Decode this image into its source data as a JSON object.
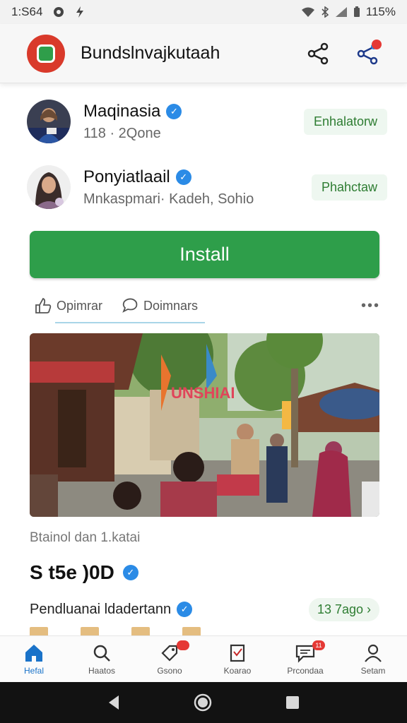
{
  "status_bar": {
    "time": "1:S64",
    "battery": "115%"
  },
  "app_bar": {
    "title": "Bundslnvajkutaah"
  },
  "accounts": [
    {
      "name": "Maqinasia",
      "sub": "118 · 2Qone",
      "chip": "Enhalatorw"
    },
    {
      "name": "Ponyiatlaail",
      "sub": "Mnkaspmari· Kadeh, Sohio",
      "chip": "Phahctaw"
    }
  ],
  "install": {
    "label": "Install"
  },
  "tabs": [
    {
      "label": "Opimrar"
    },
    {
      "label": "Doimnars"
    }
  ],
  "more": "•••",
  "media": {
    "sign_text": "UNSHIAI"
  },
  "media_caption": "Btainol dan 1.katai",
  "price": "S  t5e    )0D",
  "developer": {
    "name": "Pendluanai ldadertann",
    "chip": "13 7ago ›"
  },
  "bottom_nav": [
    {
      "label": "Hefal",
      "icon": "home-icon",
      "active": true
    },
    {
      "label": "Haatos",
      "icon": "search-icon",
      "active": false
    },
    {
      "label": "Gsono",
      "icon": "tag-icon",
      "active": false,
      "badge": ""
    },
    {
      "label": "Koarao",
      "icon": "document-icon",
      "active": false
    },
    {
      "label": "Prcondaa",
      "icon": "chat-icon",
      "active": false,
      "badge": "11"
    },
    {
      "label": "Setam",
      "icon": "person-icon",
      "active": false
    }
  ],
  "colors": {
    "accent_green": "#2e9e4a",
    "verified_blue": "#2b8be6",
    "logo_red": "#d93a2b",
    "active_blue": "#1a73c9"
  }
}
